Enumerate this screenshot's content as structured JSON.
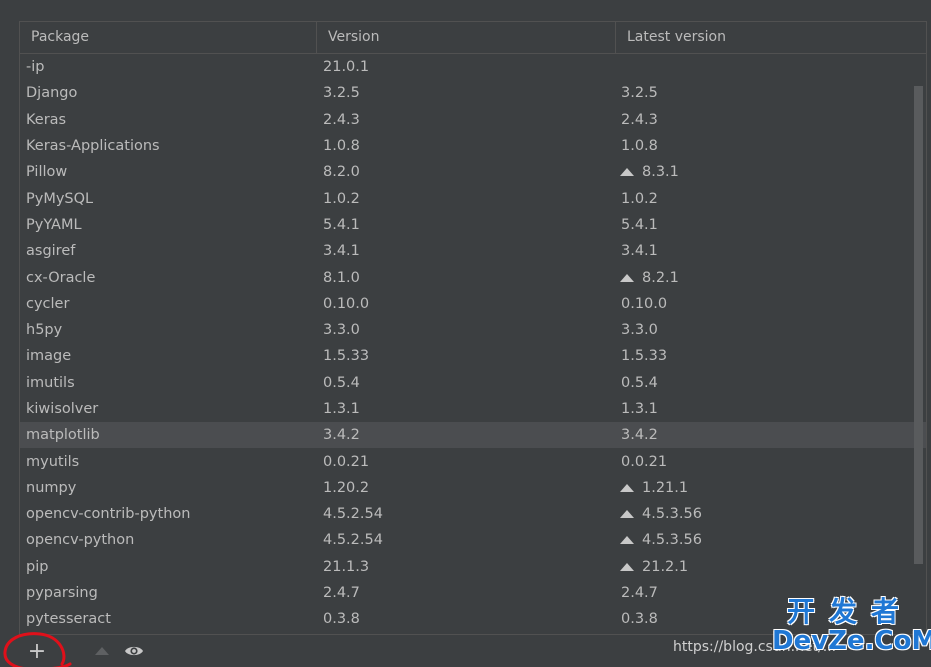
{
  "table": {
    "columns": [
      "Package",
      "Version",
      "Latest version"
    ],
    "rows": [
      {
        "package": "-ip",
        "version": "21.0.1",
        "latest": "",
        "upgrade": false
      },
      {
        "package": "Django",
        "version": "3.2.5",
        "latest": "3.2.5",
        "upgrade": false
      },
      {
        "package": "Keras",
        "version": "2.4.3",
        "latest": "2.4.3",
        "upgrade": false
      },
      {
        "package": "Keras-Applications",
        "version": "1.0.8",
        "latest": "1.0.8",
        "upgrade": false
      },
      {
        "package": "Pillow",
        "version": "8.2.0",
        "latest": "8.3.1",
        "upgrade": true
      },
      {
        "package": "PyMySQL",
        "version": "1.0.2",
        "latest": "1.0.2",
        "upgrade": false
      },
      {
        "package": "PyYAML",
        "version": "5.4.1",
        "latest": "5.4.1",
        "upgrade": false
      },
      {
        "package": "asgiref",
        "version": "3.4.1",
        "latest": "3.4.1",
        "upgrade": false
      },
      {
        "package": "cx-Oracle",
        "version": "8.1.0",
        "latest": "8.2.1",
        "upgrade": true
      },
      {
        "package": "cycler",
        "version": "0.10.0",
        "latest": "0.10.0",
        "upgrade": false
      },
      {
        "package": "h5py",
        "version": "3.3.0",
        "latest": "3.3.0",
        "upgrade": false
      },
      {
        "package": "image",
        "version": "1.5.33",
        "latest": "1.5.33",
        "upgrade": false
      },
      {
        "package": "imutils",
        "version": "0.5.4",
        "latest": "0.5.4",
        "upgrade": false
      },
      {
        "package": "kiwisolver",
        "version": "1.3.1",
        "latest": "1.3.1",
        "upgrade": false
      },
      {
        "package": "matplotlib",
        "version": "3.4.2",
        "latest": "3.4.2",
        "upgrade": false,
        "selected": true
      },
      {
        "package": "myutils",
        "version": "0.0.21",
        "latest": "0.0.21",
        "upgrade": false
      },
      {
        "package": "numpy",
        "version": "1.20.2",
        "latest": "1.21.1",
        "upgrade": true
      },
      {
        "package": "opencv-contrib-python",
        "version": "4.5.2.54",
        "latest": "4.5.3.56",
        "upgrade": true
      },
      {
        "package": "opencv-python",
        "version": "4.5.2.54",
        "latest": "4.5.3.56",
        "upgrade": true
      },
      {
        "package": "pip",
        "version": "21.1.3",
        "latest": "21.2.1",
        "upgrade": true
      },
      {
        "package": "pyparsing",
        "version": "2.4.7",
        "latest": "2.4.7",
        "upgrade": false
      },
      {
        "package": "pytesseract",
        "version": "0.3.8",
        "latest": "0.3.8",
        "upgrade": false
      }
    ]
  },
  "toolbar": {
    "add_label": "+",
    "add_icon": "plus-icon",
    "upgrade_icon": "up-triangle-icon",
    "show_early_releases_icon": "eye-icon"
  },
  "watermark": {
    "url": "https://blog.csdn.net/...",
    "logo_cn": "开发者",
    "logo_en": "DevZe.CoM"
  },
  "colors": {
    "background": "#3c3f41",
    "text": "#bbbbbb",
    "selected_row": "#4b4d50",
    "annotation": "#e0101a",
    "logo_blue": "#1f77d4"
  }
}
